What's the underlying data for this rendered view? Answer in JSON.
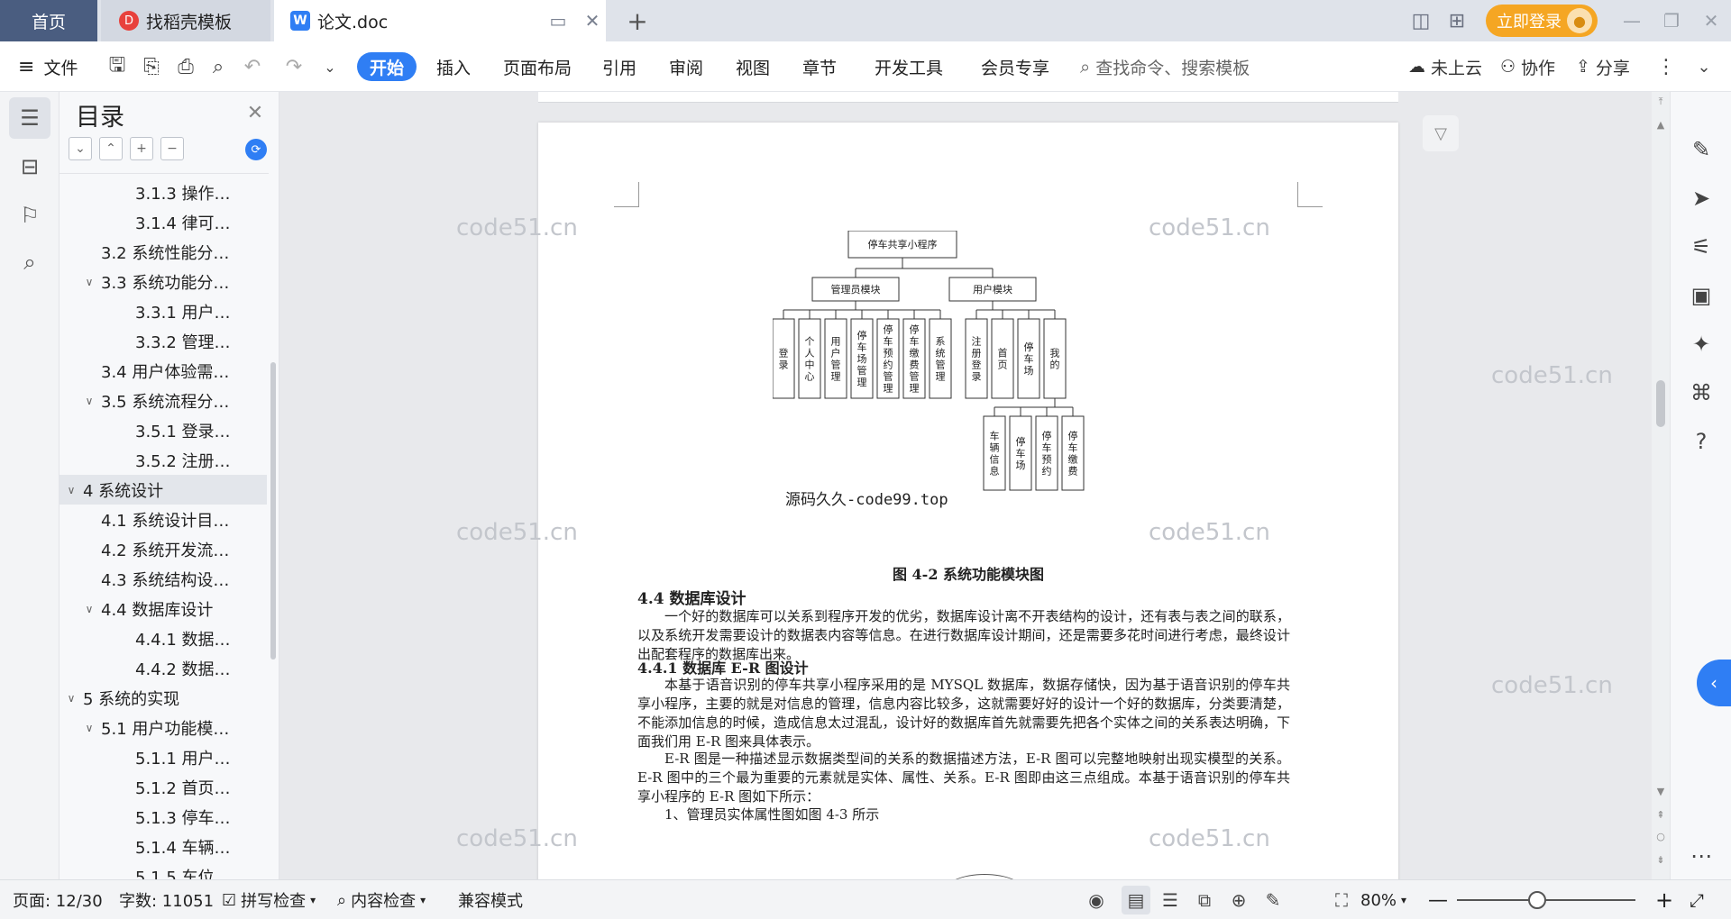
{
  "tabs": {
    "home": "首页",
    "template": "找稻壳模板",
    "document": "论文.doc",
    "login": "立即登录"
  },
  "menu": {
    "file": "文件",
    "items": [
      "开始",
      "插入",
      "页面布局",
      "引用",
      "审阅",
      "视图",
      "章节",
      "开发工具",
      "会员专享"
    ],
    "search_placeholder": "查找命令、搜索模板",
    "cloud": "未上云",
    "collab": "协作",
    "share": "分享"
  },
  "toc": {
    "title": "目录",
    "items": [
      {
        "label": "3.1.3 操作…",
        "level": 3,
        "chevron": false
      },
      {
        "label": "3.1.4 律可…",
        "level": 3,
        "chevron": false
      },
      {
        "label": "3.2 系统性能分…",
        "level": 2,
        "chevron": false
      },
      {
        "label": "3.3 系统功能分…",
        "level": 2,
        "chevron": true
      },
      {
        "label": "3.3.1 用户…",
        "level": 3,
        "chevron": false
      },
      {
        "label": "3.3.2 管理…",
        "level": 3,
        "chevron": false
      },
      {
        "label": "3.4 用户体验需…",
        "level": 2,
        "chevron": false
      },
      {
        "label": "3.5 系统流程分…",
        "level": 2,
        "chevron": true
      },
      {
        "label": "3.5.1 登录…",
        "level": 3,
        "chevron": false
      },
      {
        "label": "3.5.2 注册…",
        "level": 3,
        "chevron": false
      },
      {
        "label": "4 系统设计",
        "level": 1,
        "chevron": true,
        "selected": true
      },
      {
        "label": "4.1 系统设计目…",
        "level": 2,
        "chevron": false
      },
      {
        "label": "4.2 系统开发流…",
        "level": 2,
        "chevron": false
      },
      {
        "label": "4.3 系统结构设…",
        "level": 2,
        "chevron": false
      },
      {
        "label": "4.4 数据库设计",
        "level": 2,
        "chevron": true
      },
      {
        "label": "4.4.1 数据…",
        "level": 3,
        "chevron": false
      },
      {
        "label": "4.4.2 数据…",
        "level": 3,
        "chevron": false
      },
      {
        "label": "5 系统的实现",
        "level": 1,
        "chevron": true
      },
      {
        "label": "5.1 用户功能模…",
        "level": 2,
        "chevron": true
      },
      {
        "label": "5.1.1 用户…",
        "level": 3,
        "chevron": false
      },
      {
        "label": "5.1.2 首页…",
        "level": 3,
        "chevron": false
      },
      {
        "label": "5.1.3 停车…",
        "level": 3,
        "chevron": false
      },
      {
        "label": "5.1.4 车辆…",
        "level": 3,
        "chevron": false
      },
      {
        "label": "5.1.5 车位…",
        "level": 3,
        "chevron": false
      }
    ]
  },
  "diagram": {
    "root": "停车共享小程序",
    "admin": "管理员模块",
    "user": "用户模块",
    "admin_children": [
      "登录",
      "个人中心",
      "用户管理",
      "停车场管理",
      "停车预约管理",
      "停车缴费管理",
      "系统管理"
    ],
    "user_children": [
      "注册登录",
      "首页",
      "停车场",
      "我的"
    ],
    "my_children": [
      "车辆信息",
      "停车场",
      "停车预约",
      "停车缴费"
    ]
  },
  "document": {
    "inline_watermark": "源码久久-code99.top",
    "caption": "图 4-2 系统功能模块图",
    "h2": "4.4 数据库设计",
    "p1": "一个好的数据库可以关系到程序开发的优劣，数据库设计离不开表结构的设计，还有表与表之间的联系，以及系统开发需要设计的数据表内容等信息。在进行数据库设计期间，还是需要多花时间进行考虑，最终设计出配套程序的数据库出来。",
    "h3": "4.4.1 数据库 E-R 图设计",
    "p2": "本基于语音识别的停车共享小程序采用的是 MYSQL 数据库，数据存储快，因为基于语音识别的停车共享小程序，主要的就是对信息的管理，信息内容比较多，这就需要好好的设计一个好的数据库，分类要清楚，不能添加信息的时候，造成信息太过混乱，设计好的数据库首先就需要先把各个实体之间的关系表达明确，下面我们用 E-R 图来具体表示。",
    "p3": "E-R 图是一种描述显示数据类型间的关系的数据描述方法，E-R 图可以完整地映射出现实模型的关系。E-R 图中的三个最为重要的元素就是实体、属性、关系。E-R 图即由这三点组成。本基于语音识别的停车共享小程序的 E-R 图如下所示：",
    "p4": "1、管理员实体属性图如图 4-3 所示"
  },
  "watermark": "code51.cn",
  "status": {
    "page": "页面: 12/30",
    "words": "字数: 11051",
    "spell": "拼写检查",
    "content": "内容检查",
    "compat": "兼容模式",
    "zoom": "80%",
    "zoom_level": 0.45
  },
  "colors": {
    "accent": "#2f7ef4",
    "login": "#f5a623",
    "home_tab": "#4a5d80"
  }
}
